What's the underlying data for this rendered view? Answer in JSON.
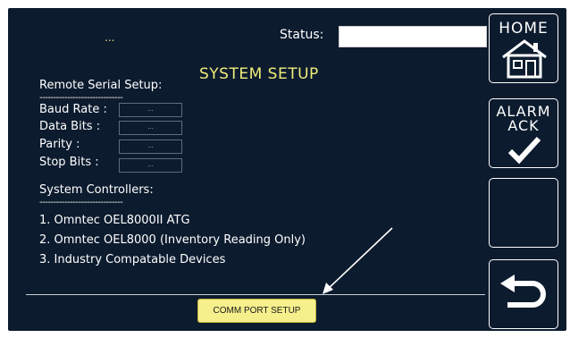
{
  "header": {
    "ellipsis": "...",
    "status_label": "Status:",
    "status_value": ""
  },
  "title": "SYSTEM SETUP",
  "remote_serial": {
    "heading": "Remote Serial Setup:",
    "separator": "------------------------------",
    "fields": [
      {
        "label": "Baud Rate :",
        "value": "..."
      },
      {
        "label": "Data Bits   :",
        "value": "..."
      },
      {
        "label": "Parity        :",
        "value": "..."
      },
      {
        "label": "Stop Bits   :",
        "value": "..."
      }
    ]
  },
  "system_controllers": {
    "heading": "System Controllers:",
    "separator": "------------------------------",
    "items": [
      "1. Omntec OEL8000II ATG",
      "2. Omntec OEL8000 (Inventory Reading Only)",
      "3. Industry Compatable Devices"
    ]
  },
  "comm_port_button": "COMM PORT SETUP",
  "side": {
    "home_label": "HOME",
    "alarm_label_1": "ALARM",
    "alarm_label_2": "ACK"
  },
  "colors": {
    "background": "#0c1b2e",
    "title": "#f0ec7a",
    "button_fill": "#f5ef8c"
  }
}
